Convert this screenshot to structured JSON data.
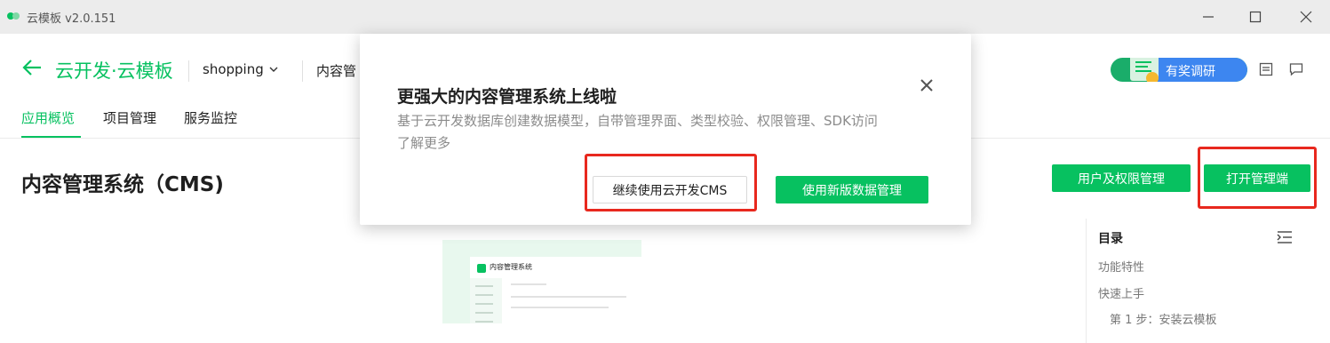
{
  "window": {
    "title": "云模板 v2.0.151",
    "controls": [
      "minimize-icon",
      "maximize-icon",
      "close-icon"
    ]
  },
  "header": {
    "brand": "云开发·云模板",
    "env_selected": "shopping",
    "breadcrumb_partial": "内容管",
    "survey_label": "有奖调研"
  },
  "tabs": [
    {
      "label": "应用概览",
      "active": true
    },
    {
      "label": "项目管理",
      "active": false
    },
    {
      "label": "服务监控",
      "active": false
    }
  ],
  "page": {
    "title": "内容管理系统（CMS)",
    "buttons": {
      "user_permissions": "用户及权限管理",
      "open_admin": "打开管理端"
    }
  },
  "toc": {
    "title": "目录",
    "items": [
      "功能特性",
      "快速上手",
      "第 1 步：安装云模板"
    ]
  },
  "preview": {
    "title": "内容管理系统"
  },
  "modal": {
    "title": "更强大的内容管理系统上线啦",
    "description": "基于云开发数据库创建数据模型，自带管理界面、类型校验、权限管理、SDK访问",
    "link": "了解更多",
    "secondary_button": "继续使用云开发CMS",
    "primary_button": "使用新版数据管理"
  },
  "colors": {
    "accent": "#07c160",
    "highlight_box": "#e8281e",
    "survey_blue": "#3d86f0",
    "titlebar": "#ececec"
  }
}
